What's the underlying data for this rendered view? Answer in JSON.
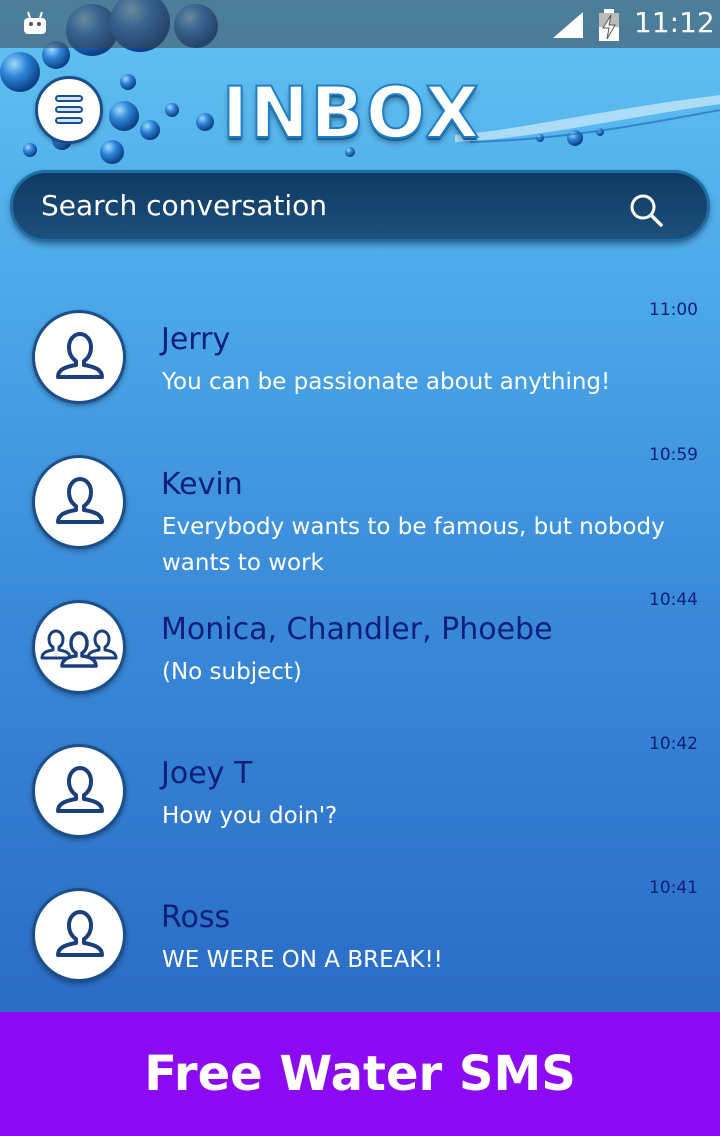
{
  "status_bar": {
    "time": "11:12"
  },
  "header": {
    "title": "INBOX"
  },
  "search": {
    "placeholder": "Search conversation"
  },
  "conversations": [
    {
      "name": "Jerry",
      "time": "11:00",
      "message": " You can be passionate about anything!",
      "avatar": "person-icon"
    },
    {
      "name": "Kevin",
      "time": "10:59",
      "message": " Everybody wants to be famous, but nobody wants to work",
      "avatar": "person-icon"
    },
    {
      "name": "Monica, Chandler, Phoebe",
      "time": "10:44",
      "message": "(No subject)",
      "avatar": "group-icon"
    },
    {
      "name": "Joey T",
      "time": "10:42",
      "message": "How you doin'?",
      "avatar": "person-icon"
    },
    {
      "name": "Ross",
      "time": "10:41",
      "message": "WE WERE ON A BREAK!!",
      "avatar": "person-icon"
    }
  ],
  "banner": {
    "text": "Free Water SMS",
    "color": "#8d0af5"
  }
}
